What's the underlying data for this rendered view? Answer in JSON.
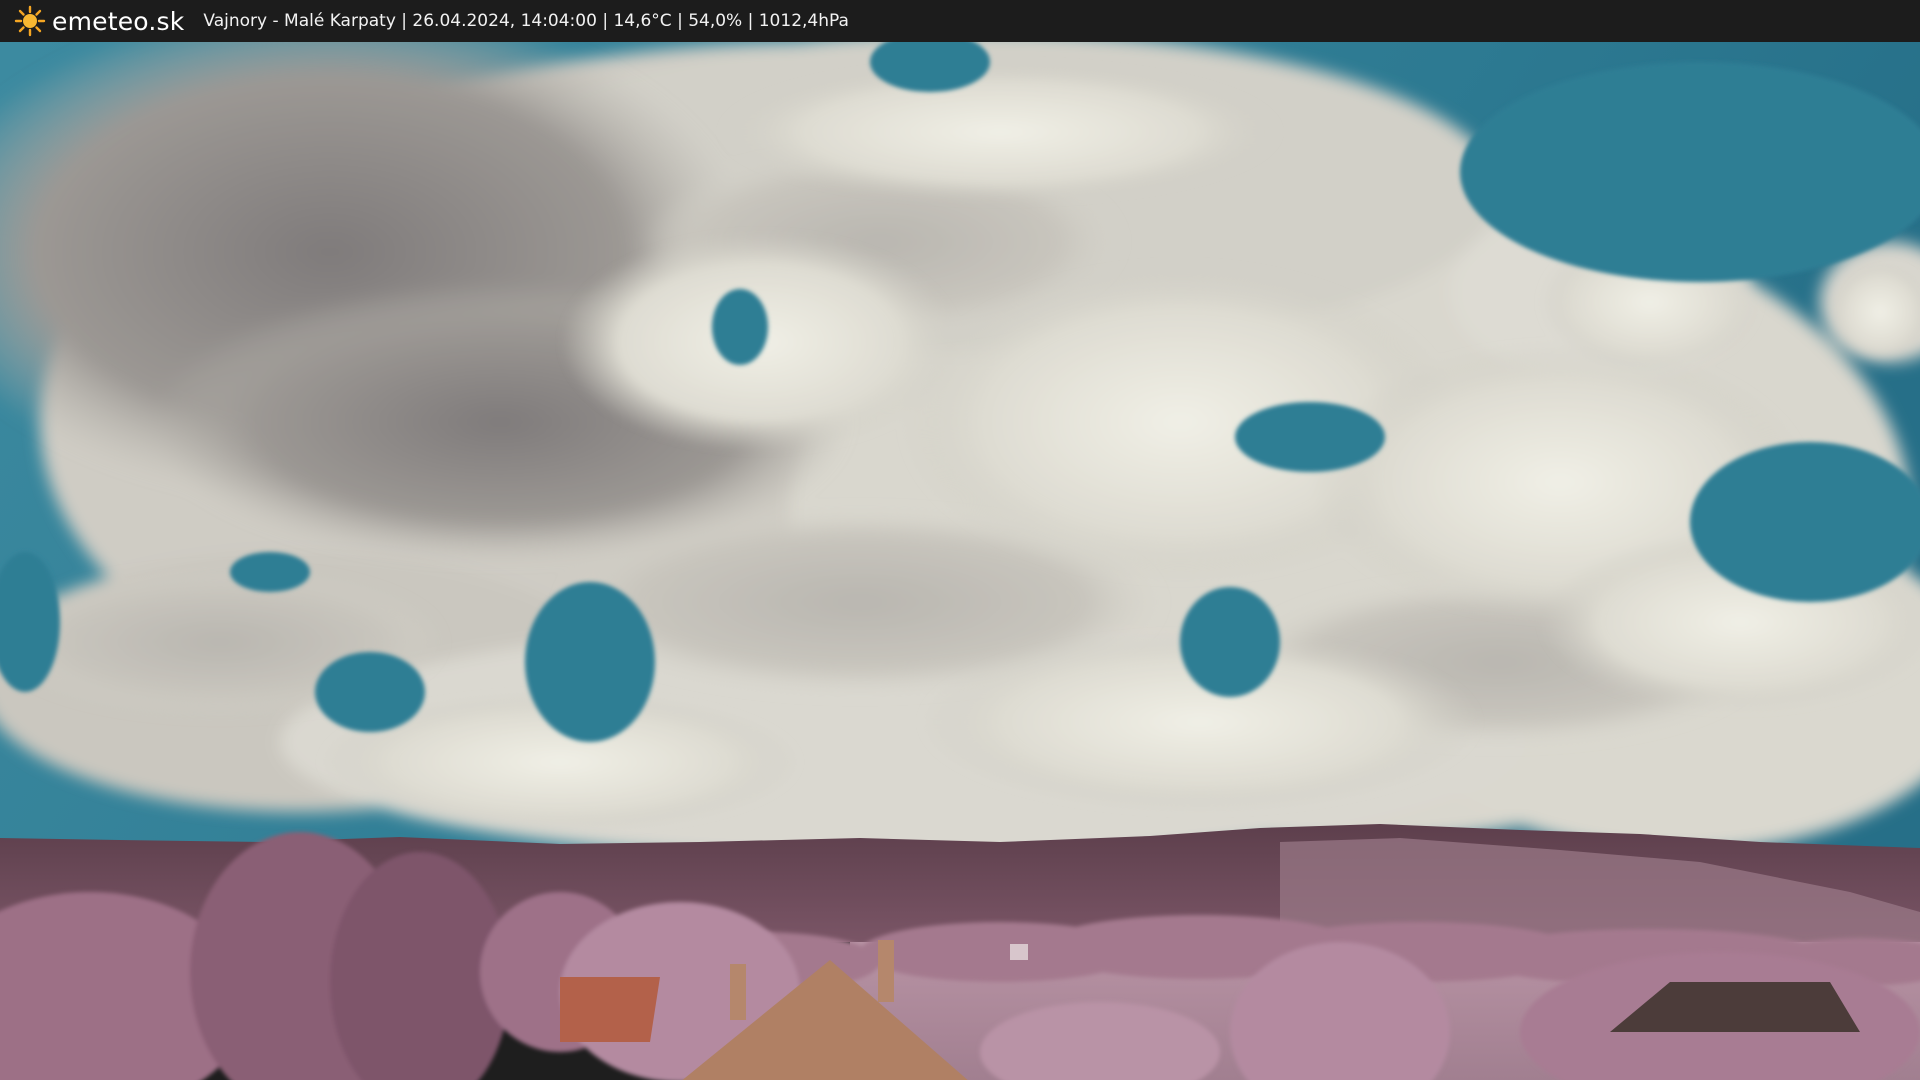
{
  "header": {
    "brand": "emeteo.sk",
    "logo_icon": "sun-icon",
    "caption": "Vajnory - Malé Karpaty | 26.04.2024, 14:04:00 | 14,6°C | 54,0% | 1012,4hPa"
  },
  "image": {
    "description_icon": "webcam-image"
  },
  "colors": {
    "bar": "#1c1c1c",
    "sky": "#2f7e94",
    "cloud_light": "#e6e5dc",
    "cloud_dark": "#8e8b87",
    "hills": "#6b4a58",
    "foliage": "#b07f97",
    "roof": "#b3614a"
  }
}
